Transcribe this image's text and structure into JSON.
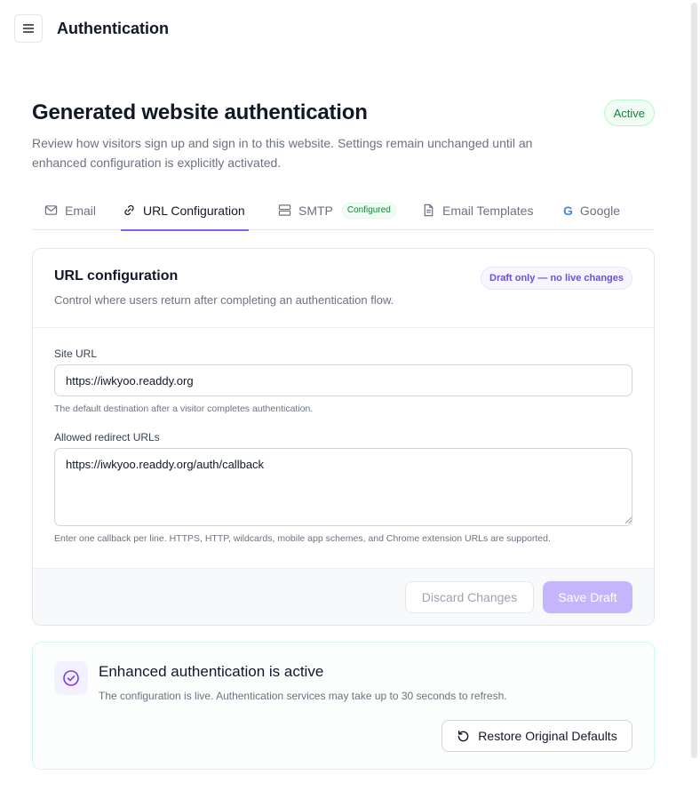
{
  "app": {
    "title": "Authentication"
  },
  "header": {
    "title": "Generated website authentication",
    "status": "Active",
    "description": "Review how visitors sign up and sign in to this website. Settings remain unchanged until an enhanced configuration is explicitly activated."
  },
  "tabs": {
    "email": "Email",
    "url_config": "URL Configuration",
    "smtp": "SMTP",
    "smtp_badge": "Configured",
    "templates": "Email Templates",
    "google": "Google",
    "google_glyph": "G",
    "active": "url_config"
  },
  "card": {
    "title": "URL configuration",
    "subtitle": "Control where users return after completing an authentication flow.",
    "draft_badge": "Draft only — no live changes",
    "site_url_label": "Site URL",
    "site_url_value": "https://iwkyoo.readdy.org",
    "site_url_help": "The default destination after a visitor completes authentication.",
    "redirect_label": "Allowed redirect URLs",
    "redirect_value": "https://iwkyoo.readdy.org/auth/callback",
    "redirect_help": "Enter one callback per line. HTTPS, HTTP, wildcards, mobile app schemes, and Chrome extension URLs are supported.",
    "discard_label": "Discard Changes",
    "save_label": "Save Draft"
  },
  "notice": {
    "title": "Enhanced authentication is active",
    "description": "The configuration is live. Authentication services may take up to 30 seconds to refresh.",
    "restore_label": "Restore Original Defaults"
  },
  "colors": {
    "accent": "#8b5cf6",
    "success": "#15803d",
    "save_disabled": "#c4b5fd"
  }
}
